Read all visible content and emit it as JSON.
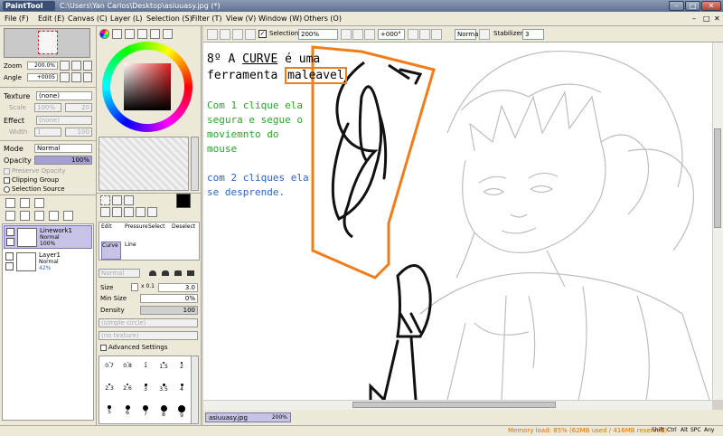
{
  "window": {
    "app_logo": "PaintTool SAI",
    "title": "C:\\Users\\Yan Carlos\\Desktop\\asiuuasy.jpg (*)"
  },
  "menu": [
    "File (F)",
    "Edit (E)",
    "Canvas (C)",
    "Layer (L)",
    "Selection (S)",
    "Filter (T)",
    "View (V)",
    "Window (W)",
    "Others (O)"
  ],
  "toolbar": {
    "selection_label": "Selection",
    "zoom": "200%",
    "angle": "+000°",
    "mode": "Normal",
    "stabilizer_label": "Stabilizer",
    "stabilizer_value": "3"
  },
  "navigator": {
    "zoom_label": "Zoom",
    "zoom_value": "200.0%",
    "angle_label": "Angle",
    "angle_value": "+0005"
  },
  "texture": {
    "label": "Texture",
    "value": "(none)",
    "scale_label": "Scale",
    "scale_value": "100%",
    "scale_num": "20"
  },
  "effect": {
    "label": "Effect",
    "value": "(none)",
    "width_label": "Width",
    "width_value": "1",
    "width_num": "100"
  },
  "layer_props": {
    "mode_label": "Mode",
    "mode_value": "Normal",
    "opacity_label": "Opacity",
    "opacity_value": "100%",
    "preserve_opacity": "Preserve Opacity",
    "clipping_group": "Clipping Group",
    "selection_source": "Selection Source"
  },
  "layers": [
    {
      "name": "Linework1",
      "mode": "Normal",
      "opacity": "100%"
    },
    {
      "name": "Layer1",
      "mode": "Normal",
      "opacity": "42%"
    }
  ],
  "tools": {
    "edit": "Edit",
    "pressure": "Pressure",
    "select": "Select",
    "deselect": "Deselect",
    "curve": "Curve",
    "line": "Line"
  },
  "brush": {
    "mode": "Normal",
    "size_label": "Size",
    "size_mult": "x 0.1",
    "size_value": "3.0",
    "minsize_label": "Min Size",
    "minsize_value": "0%",
    "density_label": "Density",
    "density_value": "100",
    "shape": "(simple circle)",
    "texture": "(no texture)",
    "advanced": "Advanced Settings"
  },
  "brush_sizes": [
    "0.7",
    "0.8",
    "1",
    "1.5",
    "2",
    "2.3",
    "2.6",
    "3",
    "3.5",
    "4",
    "5",
    "6",
    "7",
    "8",
    "9"
  ],
  "annotation": {
    "line1_a": "8º A ",
    "line1_b": "CURVE",
    "line1_c": " é uma",
    "line2_a": "ferramenta ",
    "line2_b": "maleavel",
    "green_text": [
      "Com 1 clique ela",
      "segura e segue o",
      "moviemnto do",
      "mouse"
    ],
    "blue_text": [
      "com 2 cliques ela",
      "se desprende."
    ]
  },
  "document_tab": {
    "name": "asiuuasy.jpg",
    "zoom": "200%"
  },
  "status": {
    "memory": "Memory load: 85% (62MB used / 416MB reserved)",
    "keys": [
      "Shift",
      "Ctrl",
      "Alt",
      "SPC",
      "Any"
    ]
  },
  "colors": {
    "annotation_orange": "#f07d1a",
    "green_text": "#2aa52a",
    "blue_text": "#2a64c8",
    "layer_selected": "#c7c3e6"
  }
}
